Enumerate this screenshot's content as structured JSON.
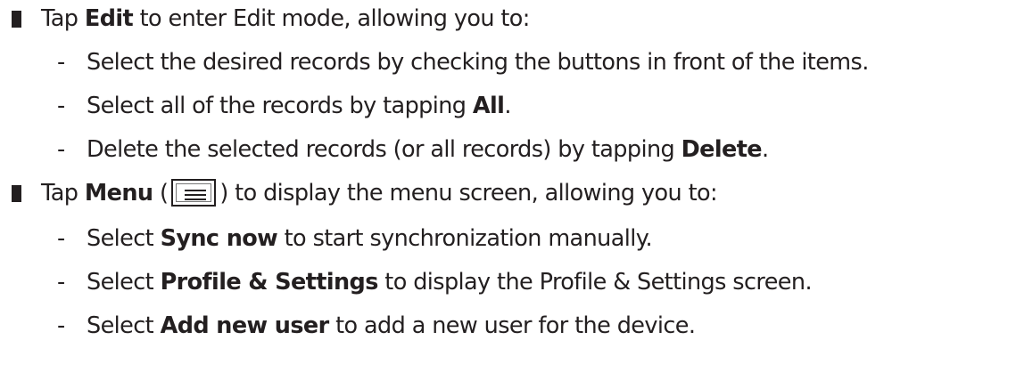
{
  "sections": [
    {
      "intro": {
        "before": "Tap ",
        "bold": "Edit",
        "after": " to enter Edit mode, allowing you to:"
      },
      "items": [
        {
          "before": "Select the desired records by checking the buttons in front of the items.",
          "bold": "",
          "after": ""
        },
        {
          "before": "Select all of the records by tapping ",
          "bold": "All",
          "after": "."
        },
        {
          "before": "Delete the selected records (or all records) by tapping ",
          "bold": "Delete",
          "after": "."
        }
      ]
    },
    {
      "intro": {
        "before": "Tap ",
        "bold": "Menu",
        "paren_open": " (",
        "icon": "menu-icon",
        "paren_close": ")",
        "after": " to display the menu screen, allowing you to:"
      },
      "items": [
        {
          "before": "Select ",
          "bold": "Sync now",
          "after": " to start synchronization manually."
        },
        {
          "before": "Select ",
          "bold": "Profile & Settings",
          "after": " to display the Profile & Settings screen."
        },
        {
          "before": "Select ",
          "bold": "Add new user",
          "after": " to add a new user for the device."
        }
      ]
    }
  ],
  "dash_glyph": "-"
}
